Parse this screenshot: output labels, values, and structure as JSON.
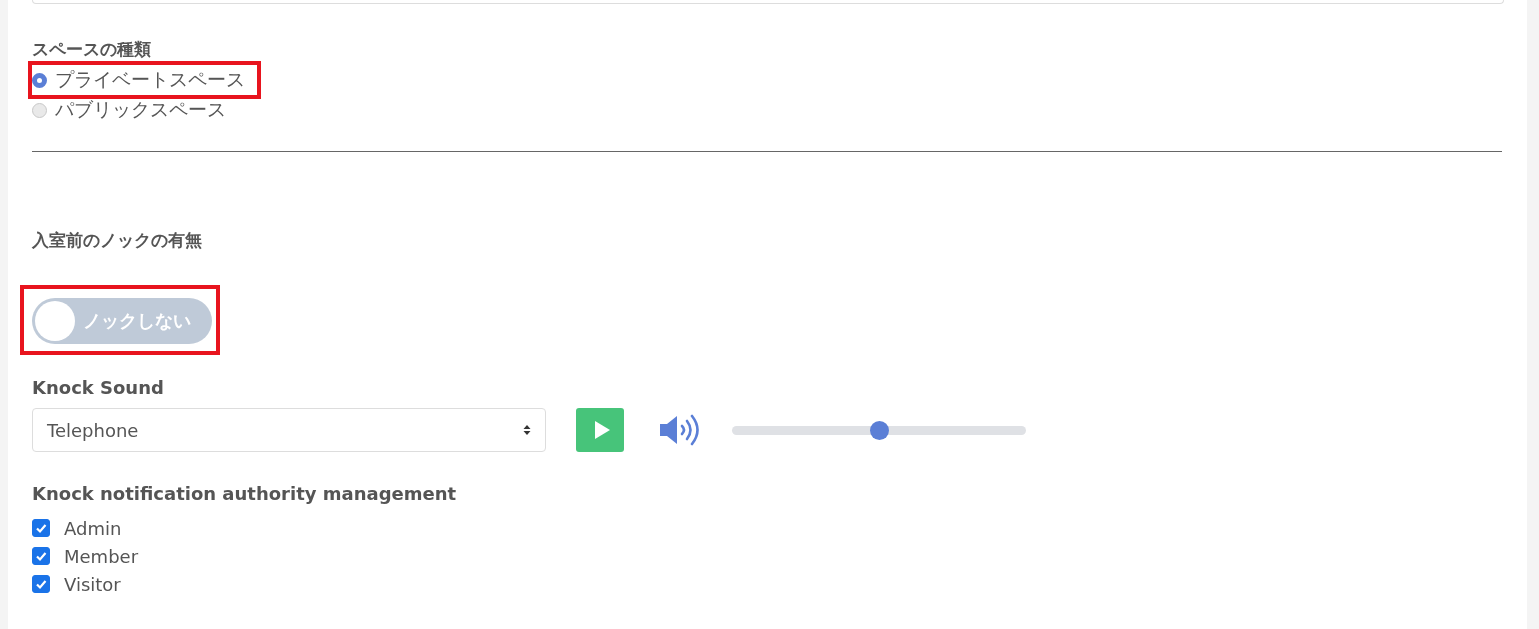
{
  "space_type": {
    "heading": "スペースの種類",
    "options": [
      {
        "label": "プライベートスペース",
        "selected": true,
        "highlighted": true
      },
      {
        "label": "パブリックスペース",
        "selected": false,
        "highlighted": false
      }
    ]
  },
  "knock": {
    "heading": "入室前のノックの有無",
    "toggle": {
      "label": "ノックしない",
      "on": false,
      "highlighted": true
    }
  },
  "knock_sound": {
    "heading": "Knock Sound",
    "select": {
      "value": "Telephone"
    },
    "volume": {
      "level": 0.5
    }
  },
  "authority": {
    "heading": "Knock notification authority management",
    "items": [
      {
        "label": "Admin",
        "checked": true
      },
      {
        "label": "Member",
        "checked": true
      },
      {
        "label": "Visitor",
        "checked": true
      }
    ]
  }
}
